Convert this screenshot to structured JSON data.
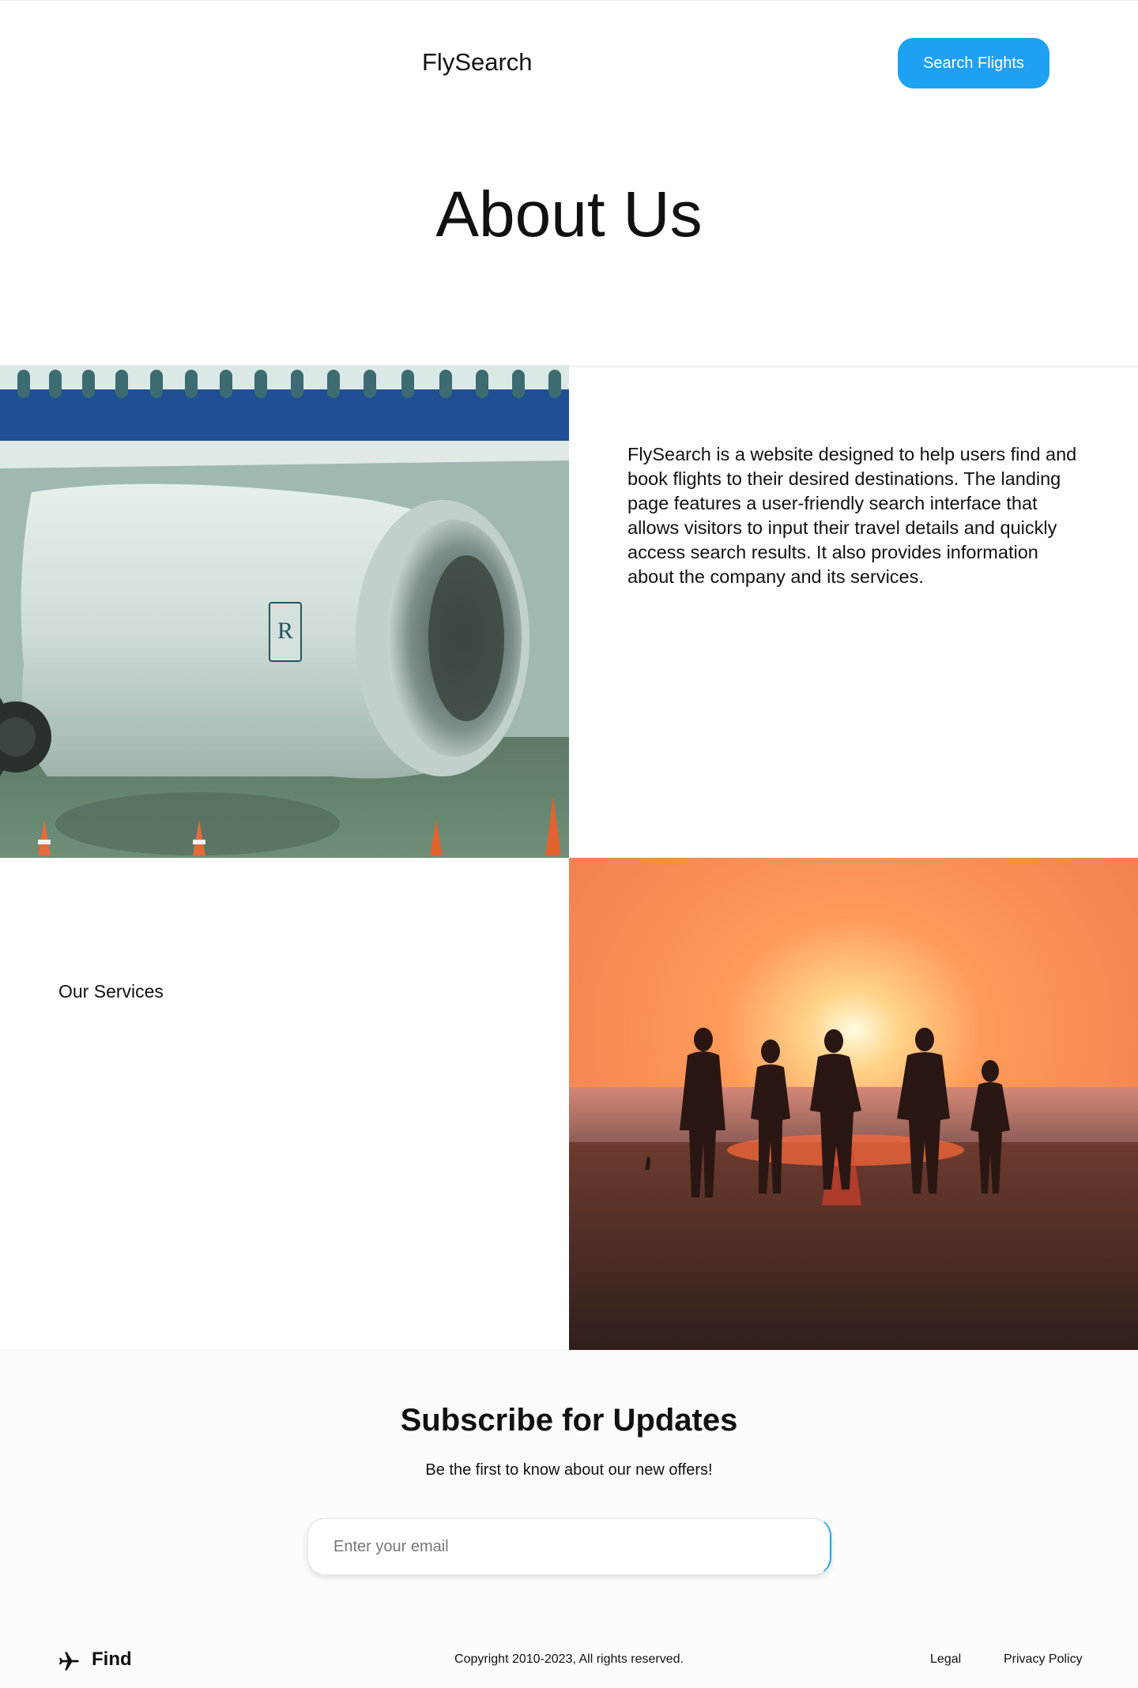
{
  "header": {
    "brand": "FlySearch",
    "cta_label": "Search Flights"
  },
  "hero": {
    "title": "About Us"
  },
  "about": {
    "text": "FlySearch is a website designed to help users find and book flights to their desired destinations. The landing page features a user-friendly search interface that allows visitors to input their travel details and quickly access search results. It also provides information about the company and its services."
  },
  "services": {
    "label": "Our Services"
  },
  "subscribe": {
    "title": "Subscribe for Updates",
    "description": "Be the first to know about our new offers!",
    "email_placeholder": "Enter your email",
    "email_value": ""
  },
  "footer": {
    "brand": "Find",
    "copyright": "Copyright 2010-2023, All rights reserved.",
    "legal": "Legal",
    "privacy": "Privacy Policy"
  },
  "images": {
    "engine": "jet-engine-photo",
    "sunset": "family-beach-sunset-photo"
  },
  "colors": {
    "accent": "#1ea1f2"
  }
}
